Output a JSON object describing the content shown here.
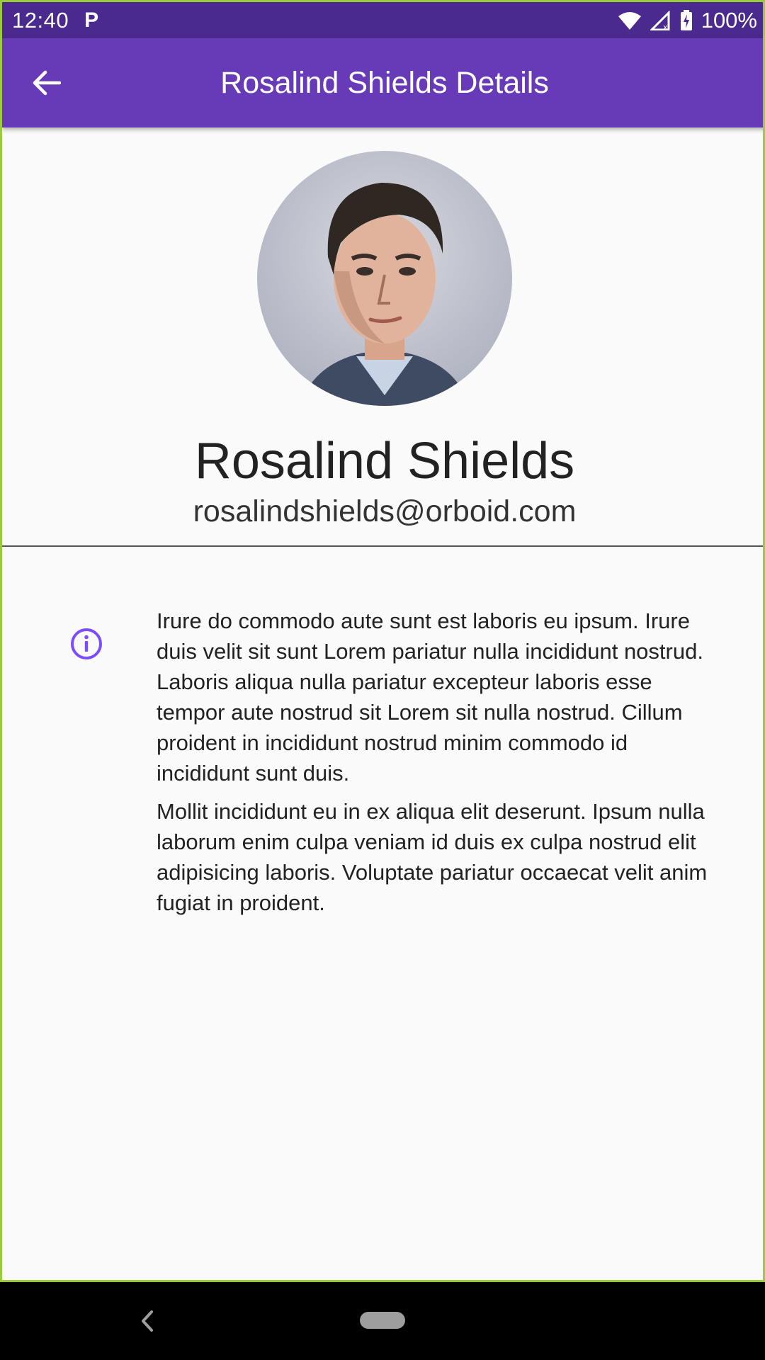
{
  "status_bar": {
    "time": "12:40",
    "notification_icon": "parking-p-icon",
    "battery": "100%"
  },
  "app_bar": {
    "title": "Rosalind Shields Details",
    "back_icon": "arrow-back-icon"
  },
  "profile": {
    "name": "Rosalind Shields",
    "email": "rosalindshields@orboid.com",
    "avatar_icon": "avatar-photo"
  },
  "details": {
    "icon": "info-icon",
    "paragraphs": [
      "Irure do commodo aute sunt est laboris eu ipsum. Irure duis velit sit sunt Lorem pariatur nulla incididunt nostrud. Laboris aliqua nulla pariatur excepteur laboris esse tempor aute nostrud sit Lorem sit nulla nostrud. Cillum proident in incididunt nostrud minim commodo id incididunt sunt duis.",
      "Mollit incididunt eu in ex aliqua elit deserunt. Ipsum nulla laborum enim culpa veniam id duis ex culpa nostrud elit adipisicing laboris. Voluptate pariatur occaecat velit anim fugiat in proident."
    ]
  },
  "colors": {
    "status_bar": "#4b2a8f",
    "app_bar": "#673ab7",
    "accent": "#7c4dff",
    "background": "#fafafa"
  }
}
